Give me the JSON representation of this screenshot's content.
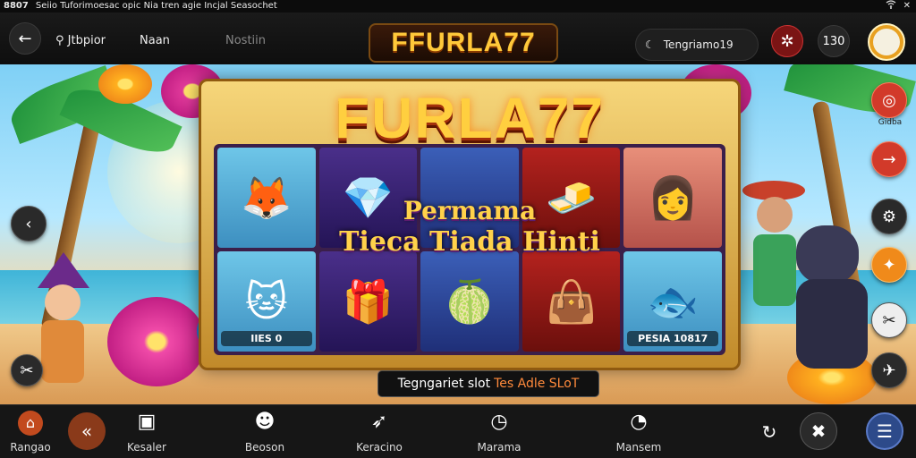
{
  "status": {
    "time": "8807",
    "ticker": "Seiio Tuforimoesac opic Nia tren agie Incjal Seasochet",
    "wifi_icon": "wifi-icon",
    "close_icon": "close-icon"
  },
  "topbar": {
    "back_icon": "arrow-left-icon",
    "nav1_label": "Jtbpior",
    "nav2_label": "Naan",
    "nav3_label": "Nostiin",
    "logo": "FFURLA77",
    "pill_label": "Tengriamo19",
    "badge_value": "130"
  },
  "game": {
    "title": "FURLA77",
    "promo_line1": "Permama",
    "promo_line2": "Tieca Tiada Hinti",
    "cell_caption_left": "IIES 0",
    "cell_caption_right": "PESIA 10817",
    "banner_text": "Tegngariet slot",
    "banner_highlight": "Tes Adle SLoT",
    "side_caption": "Gidba"
  },
  "bottomnav": {
    "items": [
      {
        "label": "Rangao",
        "icon": "home-icon"
      },
      {
        "label": "Kesaler",
        "icon": "frame-icon"
      },
      {
        "label": "Beoson",
        "icon": "user-icon"
      },
      {
        "label": "Keracino",
        "icon": "bird-icon"
      },
      {
        "label": "Marama",
        "icon": "clock-icon"
      },
      {
        "label": "Mansem",
        "icon": "gauge-icon"
      }
    ]
  },
  "colors": {
    "accent_gold": "#ffcf3f",
    "accent_red": "#d23a2a",
    "accent_orange": "#f08a1a",
    "bar_bg": "#161616"
  }
}
